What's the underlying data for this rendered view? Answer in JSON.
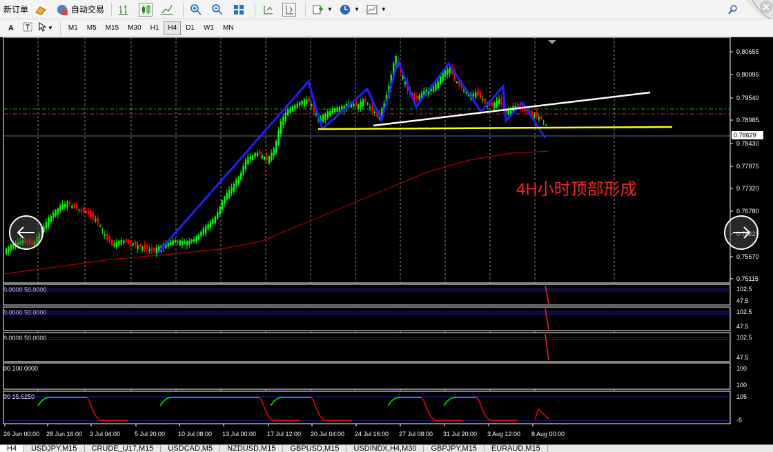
{
  "toolbar": {
    "new_order": "新订单",
    "auto_trade": "自动交易"
  },
  "timeframes": [
    "M1",
    "M5",
    "M15",
    "M30",
    "H1",
    "H4",
    "D1",
    "W1",
    "MN"
  ],
  "active_timeframe": "H4",
  "price_axis": [
    "0.80655",
    "0.80095",
    "0.79540",
    "0.78985",
    "0.78629",
    "0.78430",
    "0.77875",
    "0.77320",
    "0.76780",
    "0.76225",
    "0.75670",
    "0.75115"
  ],
  "current_price": "0.78629",
  "annotation": "4H小时顶部形成",
  "time_axis": [
    "26 Jun 00:00",
    "28 Jun 16:00",
    "3 Jul 04:00",
    "5 Jul 20:00",
    "10 Jul 08:00",
    "13 Jul 00:00",
    "17 Jul 12:00",
    "20 Jul 04:00",
    "24 Jul 16:00",
    "27 Jul 08:00",
    "31 Jul 20:00",
    "3 Aug 12:00",
    "8 Aug 00:00"
  ],
  "indicators": [
    {
      "label": "0.0000 50.0000",
      "axis": [
        "102.5",
        "47.5"
      ]
    },
    {
      "label": "0.0000 50.0000",
      "axis": [
        "102.5",
        "47.5"
      ]
    },
    {
      "label": "0.0000 50.0000",
      "axis": [
        "102.5",
        "47.5"
      ]
    },
    {
      "label": "00 100.0000",
      "axis": [
        "100",
        "100"
      ]
    },
    {
      "label": "00 15.6250",
      "axis": [
        "105",
        "-5"
      ]
    }
  ],
  "tabs": [
    "H4",
    "USDJPY,M15",
    "CRUDE_U17,M15",
    "USDCAD,M5",
    "NZDUSD,M15",
    "GBPUSD,M15",
    "USDINDX,H4,M30",
    "GBPJPY,M15",
    "EURAUD,M15"
  ],
  "colors": {
    "bull": "#00ff00",
    "bear": "#ff0000",
    "zigzag": "#2020ff",
    "trend_white": "#ffffff",
    "trend_yellow": "#ffff00",
    "ma": "#b00000",
    "annotation": "#ff2020"
  }
}
